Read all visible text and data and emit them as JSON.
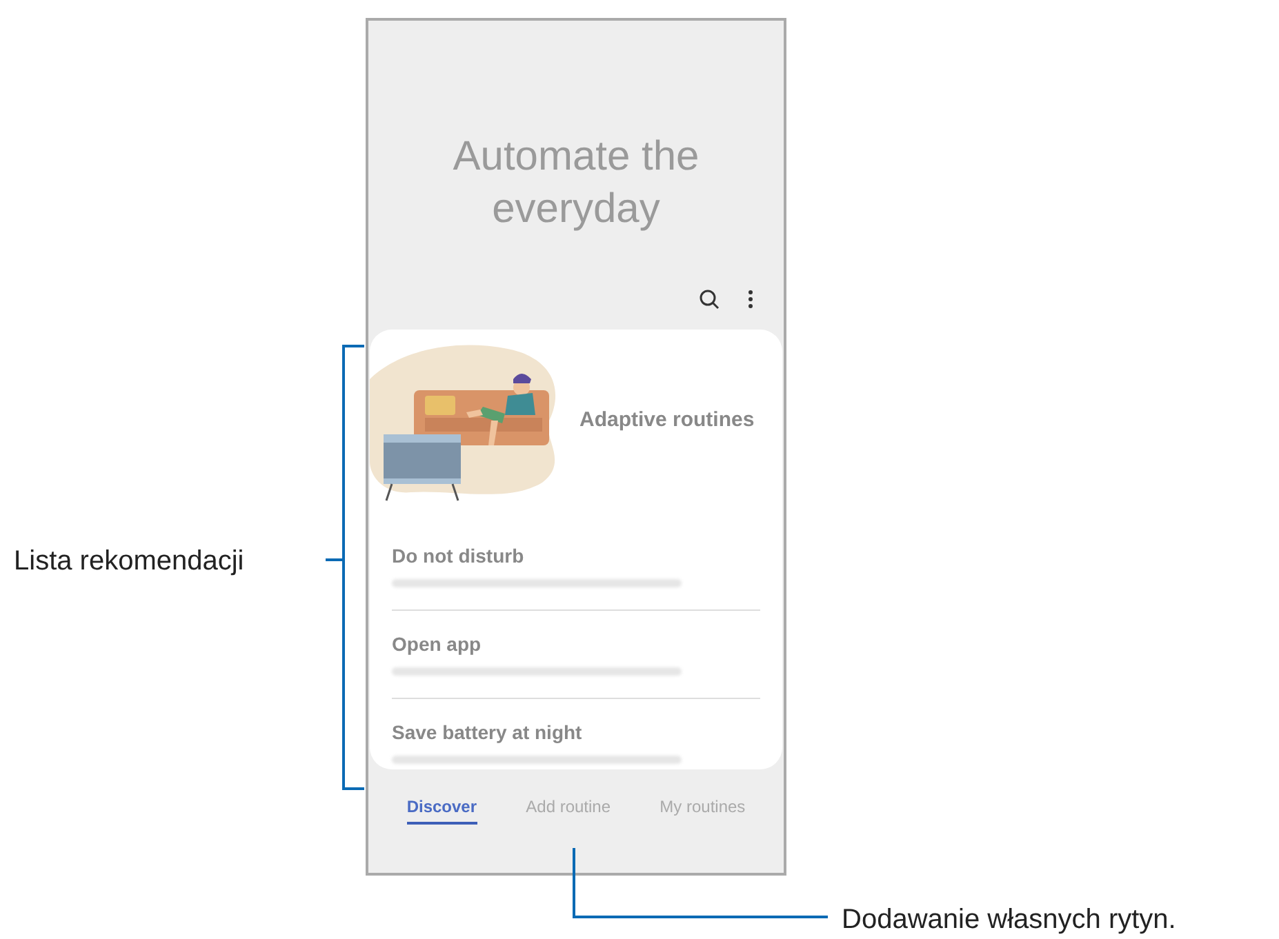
{
  "screen": {
    "title": "Automate the everyday",
    "featured": {
      "title": "Adaptive routines"
    },
    "items": [
      {
        "title": "Do not disturb"
      },
      {
        "title": "Open app"
      },
      {
        "title": "Save battery at night"
      }
    ],
    "tabs": [
      {
        "label": "Discover",
        "selected": true
      },
      {
        "label": "Add routine",
        "selected": false
      },
      {
        "label": "My routines",
        "selected": false
      }
    ]
  },
  "callouts": [
    {
      "kind": "bracket",
      "label": "Lista rekomendacji"
    },
    {
      "kind": "pointer",
      "label": "Dodawanie własnych rytyn."
    }
  ]
}
